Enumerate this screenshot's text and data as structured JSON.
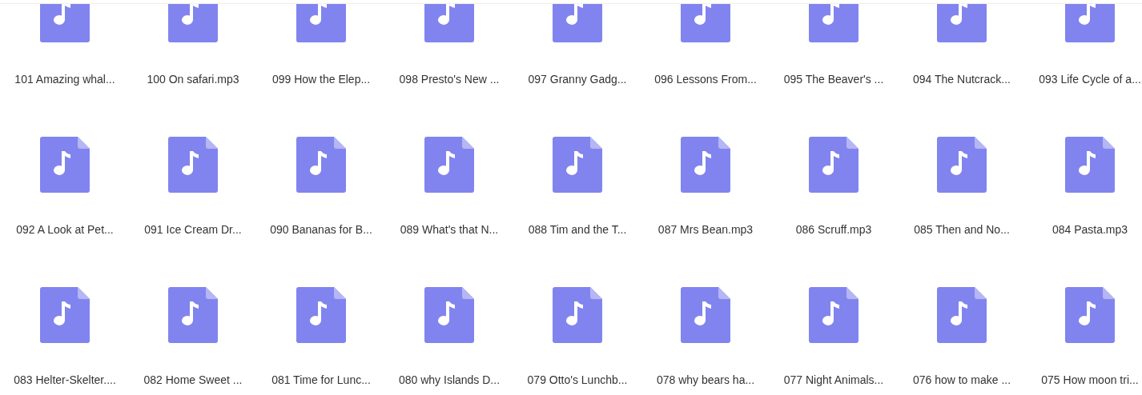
{
  "files": [
    {
      "name": "101 Amazing whal..."
    },
    {
      "name": "100 On safari.mp3"
    },
    {
      "name": "099 How the Elep..."
    },
    {
      "name": "098 Presto's New ..."
    },
    {
      "name": "097 Granny Gadg..."
    },
    {
      "name": "096 Lessons From..."
    },
    {
      "name": "095 The Beaver's ..."
    },
    {
      "name": "094 The Nutcrack..."
    },
    {
      "name": "093 Life Cycle of a..."
    },
    {
      "name": "092 A Look at Pet..."
    },
    {
      "name": "091 Ice Cream Dr..."
    },
    {
      "name": "090 Bananas for B..."
    },
    {
      "name": "089 What's that N..."
    },
    {
      "name": "088 Tim and the T..."
    },
    {
      "name": "087 Mrs Bean.mp3"
    },
    {
      "name": "086 Scruff.mp3"
    },
    {
      "name": "085 Then and No..."
    },
    {
      "name": "084 Pasta.mp3"
    },
    {
      "name": "083 Helter-Skelter...."
    },
    {
      "name": "082 Home Sweet ..."
    },
    {
      "name": "081 Time for Lunc..."
    },
    {
      "name": "080 why Islands D..."
    },
    {
      "name": "079 Otto's Lunchb..."
    },
    {
      "name": "078 why bears ha..."
    },
    {
      "name": "077 Night Animals..."
    },
    {
      "name": "076 how to make ..."
    },
    {
      "name": "075 How moon tri..."
    }
  ]
}
